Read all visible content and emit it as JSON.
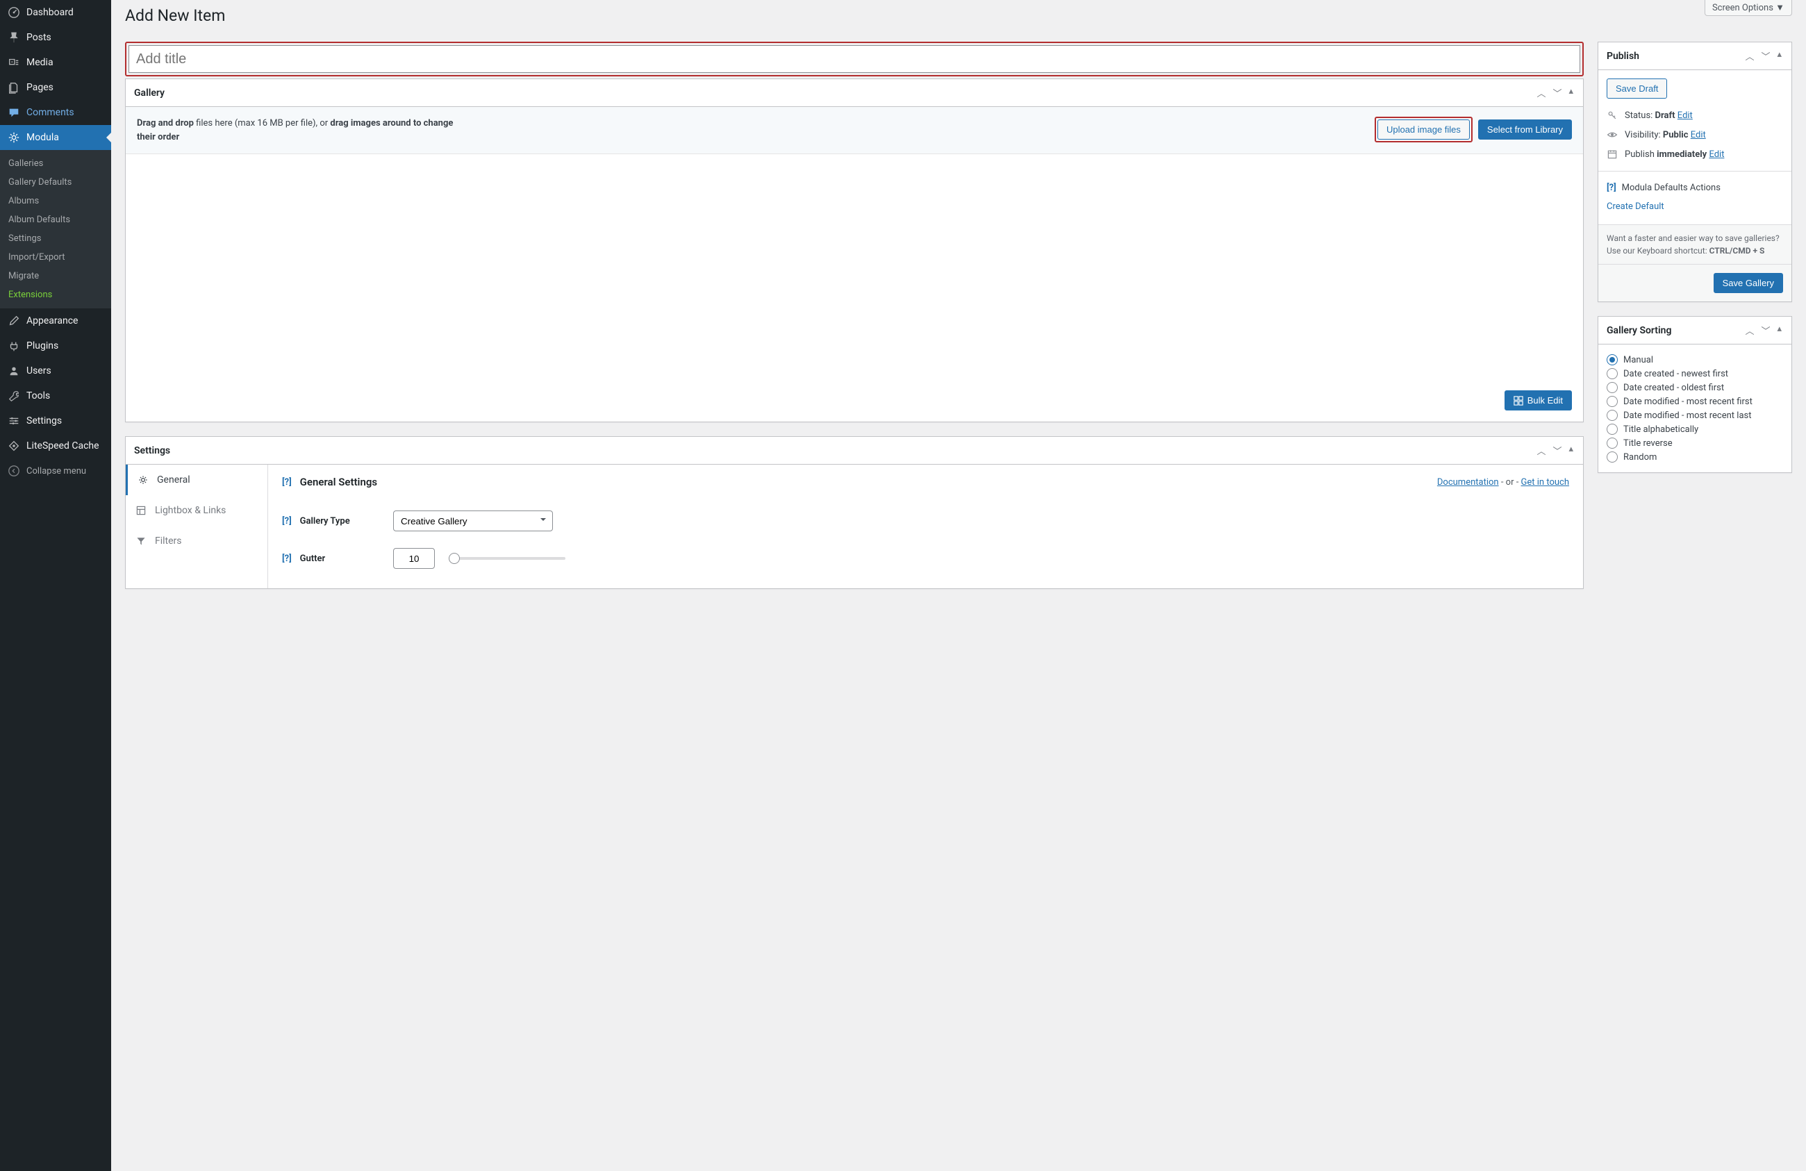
{
  "screen_options": "Screen Options ▼",
  "page_title": "Add New Item",
  "title_placeholder": "Add title",
  "sidebar": {
    "items": [
      {
        "label": "Dashboard"
      },
      {
        "label": "Posts"
      },
      {
        "label": "Media"
      },
      {
        "label": "Pages"
      },
      {
        "label": "Comments"
      },
      {
        "label": "Modula"
      },
      {
        "label": "Appearance"
      },
      {
        "label": "Plugins"
      },
      {
        "label": "Users"
      },
      {
        "label": "Tools"
      },
      {
        "label": "Settings"
      },
      {
        "label": "LiteSpeed Cache"
      }
    ],
    "submenu": [
      "Galleries",
      "Gallery Defaults",
      "Albums",
      "Album Defaults",
      "Settings",
      "Import/Export",
      "Migrate",
      "Extensions"
    ],
    "collapse": "Collapse menu"
  },
  "gallery_box": {
    "title": "Gallery",
    "drop_text_pre": "Drag and drop",
    "drop_text_mid": " files here (max 16 MB per file), or ",
    "drop_text_bold2": "drag images around to change their order",
    "upload_btn": "Upload image files",
    "library_btn": "Select from Library",
    "bulk_btn": "Bulk Edit"
  },
  "settings_box": {
    "title": "Settings",
    "tabs": [
      "General",
      "Lightbox & Links",
      "Filters"
    ],
    "heading": "General Settings",
    "doc_link": "Documentation",
    "or_text": " - or - ",
    "touch_link": "Get in touch",
    "type_label": "Gallery Type",
    "type_value": "Creative Gallery",
    "gutter_label": "Gutter",
    "gutter_value": "10"
  },
  "publish_box": {
    "title": "Publish",
    "save_draft": "Save Draft",
    "status_label": "Status: ",
    "status_value": "Draft",
    "visibility_label": "Visibility: ",
    "visibility_value": "Public",
    "publish_label": "Publish ",
    "publish_value": "immediately",
    "edit": "Edit",
    "defaults_actions": "Modula Defaults Actions",
    "create_default": "Create Default",
    "shortcut_text": "Want a faster and easier way to save galleries? Use our Keyboard shortcut: ",
    "shortcut_key": "CTRL/CMD + S",
    "save_gallery": "Save Gallery"
  },
  "sorting_box": {
    "title": "Gallery Sorting",
    "options": [
      "Manual",
      "Date created - newest first",
      "Date created - oldest first",
      "Date modified - most recent first",
      "Date modified - most recent last",
      "Title alphabetically",
      "Title reverse",
      "Random"
    ]
  },
  "help_q": "[?]"
}
